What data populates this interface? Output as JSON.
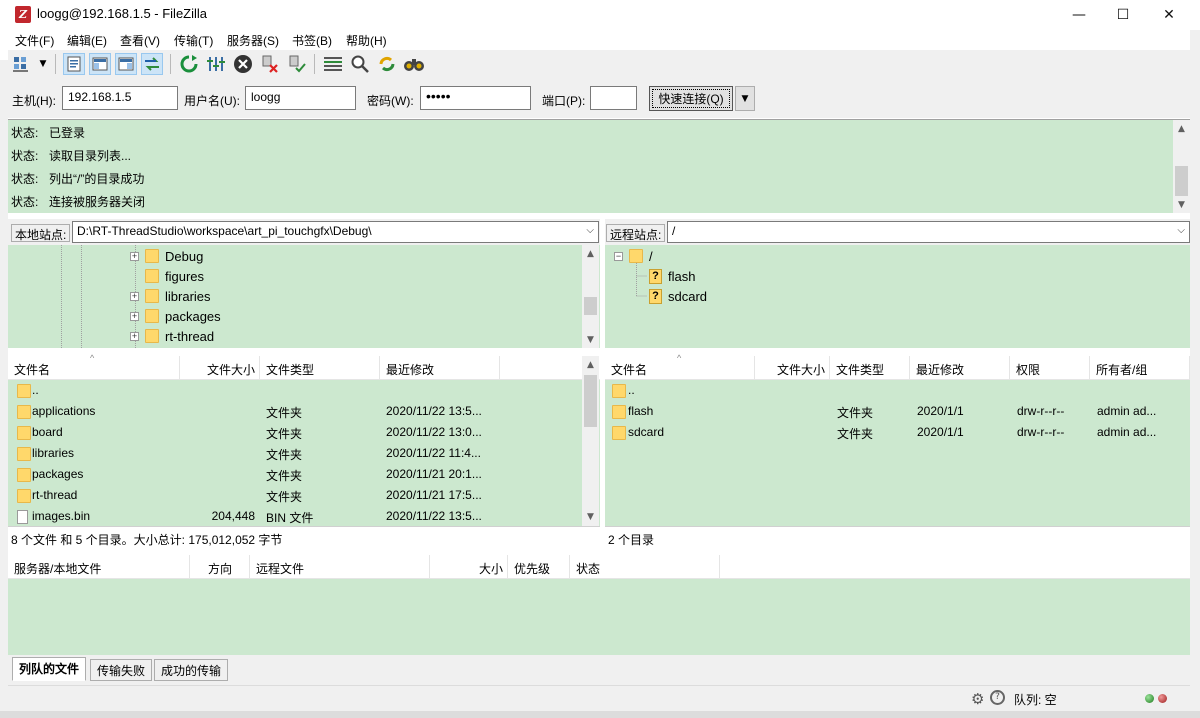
{
  "window": {
    "title": "loogg@192.168.1.5 - FileZilla",
    "minimize": "—",
    "maximize": "☐",
    "close": "✕"
  },
  "menu": [
    "文件(F)",
    "编辑(E)",
    "查看(V)",
    "传输(T)",
    "服务器(S)",
    "书签(B)",
    "帮助(H)"
  ],
  "quickconnect": {
    "host_label": "主机(H):",
    "host_value": "192.168.1.5",
    "user_label": "用户名(U):",
    "user_value": "loogg",
    "pass_label": "密码(W):",
    "pass_value": "•••••",
    "port_label": "端口(P):",
    "port_value": "",
    "button": "快速连接(Q)"
  },
  "log": [
    {
      "k": "状态:",
      "v": "已登录"
    },
    {
      "k": "状态:",
      "v": "读取目录列表..."
    },
    {
      "k": "状态:",
      "v": "列出“/”的目录成功"
    },
    {
      "k": "状态:",
      "v": "连接被服务器关闭"
    }
  ],
  "local": {
    "site_label": "本地站点:",
    "path": "D:\\RT-ThreadStudio\\workspace\\art_pi_touchgfx\\Debug\\",
    "tree": [
      {
        "name": "Debug",
        "expander": true
      },
      {
        "name": "figures",
        "expander": false
      },
      {
        "name": "libraries",
        "expander": true
      },
      {
        "name": "packages",
        "expander": true
      },
      {
        "name": "rt-thread",
        "expander": true
      }
    ],
    "headers": [
      "文件名",
      "文件大小",
      "文件类型",
      "最近修改"
    ],
    "rows": [
      {
        "name": "..",
        "size": "",
        "type": "",
        "date": "",
        "kind": "folder"
      },
      {
        "name": "applications",
        "size": "",
        "type": "文件夹",
        "date": "2020/11/22 13:5...",
        "kind": "folder"
      },
      {
        "name": "board",
        "size": "",
        "type": "文件夹",
        "date": "2020/11/22 13:0...",
        "kind": "folder"
      },
      {
        "name": "libraries",
        "size": "",
        "type": "文件夹",
        "date": "2020/11/22 11:4...",
        "kind": "folder"
      },
      {
        "name": "packages",
        "size": "",
        "type": "文件夹",
        "date": "2020/11/21 20:1...",
        "kind": "folder"
      },
      {
        "name": "rt-thread",
        "size": "",
        "type": "文件夹",
        "date": "2020/11/21 17:5...",
        "kind": "folder"
      },
      {
        "name": "images.bin",
        "size": "204,448",
        "type": "BIN 文件",
        "date": "2020/11/22 13:5...",
        "kind": "file"
      }
    ],
    "status": "8 个文件 和 5 个目录。大小总计: 175,012,052 字节"
  },
  "remote": {
    "site_label": "远程站点:",
    "path": "/",
    "tree_root": "/",
    "tree": [
      "flash",
      "sdcard"
    ],
    "headers": [
      "文件名",
      "文件大小",
      "文件类型",
      "最近修改",
      "权限",
      "所有者/组"
    ],
    "rows": [
      {
        "name": "..",
        "size": "",
        "type": "",
        "date": "",
        "perm": "",
        "owner": ""
      },
      {
        "name": "flash",
        "size": "",
        "type": "文件夹",
        "date": "2020/1/1",
        "perm": "drw-r--r--",
        "owner": "admin ad..."
      },
      {
        "name": "sdcard",
        "size": "",
        "type": "文件夹",
        "date": "2020/1/1",
        "perm": "drw-r--r--",
        "owner": "admin ad..."
      }
    ],
    "status": "2 个目录"
  },
  "queue": {
    "headers": [
      "服务器/本地文件",
      "方向",
      "远程文件",
      "大小",
      "优先级",
      "状态"
    ],
    "tabs": [
      "列队的文件",
      "传输失败",
      "成功的传输"
    ]
  },
  "statusbar": {
    "queue_label": "队列: 空"
  },
  "colors": {
    "panel_green": "#cce8cf",
    "chrome": "#f0f0f0"
  }
}
